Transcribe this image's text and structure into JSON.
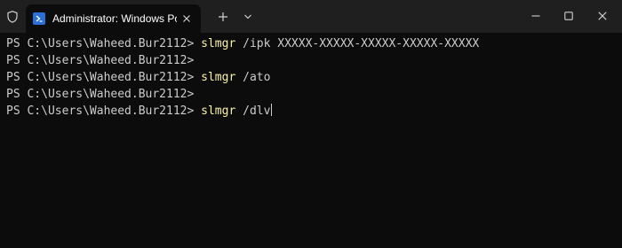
{
  "titlebar": {
    "tab_title": "Administrator: Windows PowerShell",
    "icons": {
      "shield": "shield-icon",
      "powershell": "powershell-icon",
      "tab_close": "close-icon",
      "new_tab": "plus-icon",
      "dropdown": "chevron-down-icon",
      "minimize": "minimize-icon",
      "maximize": "maximize-icon",
      "close": "close-icon"
    }
  },
  "console": {
    "lines": [
      {
        "prompt": "PS C:\\Users\\Waheed.Bur2112> ",
        "command": "slmgr",
        "args": " /ipk XXXXX-XXXXX-XXXXX-XXXXX-XXXXX"
      },
      {
        "prompt": "PS C:\\Users\\Waheed.Bur2112>",
        "command": "",
        "args": ""
      },
      {
        "prompt": "PS C:\\Users\\Waheed.Bur2112> ",
        "command": "slmgr",
        "args": " /ato"
      },
      {
        "prompt": "PS C:\\Users\\Waheed.Bur2112>",
        "command": "",
        "args": ""
      },
      {
        "prompt": "PS C:\\Users\\Waheed.Bur2112> ",
        "command": "slmgr",
        "args": " /dlv"
      }
    ]
  },
  "colors": {
    "background": "#0c0c0c",
    "titlebar": "#1f1f1f",
    "text": "#cccccc",
    "command": "#f9f1a5",
    "accent": "#2a6fd8"
  }
}
